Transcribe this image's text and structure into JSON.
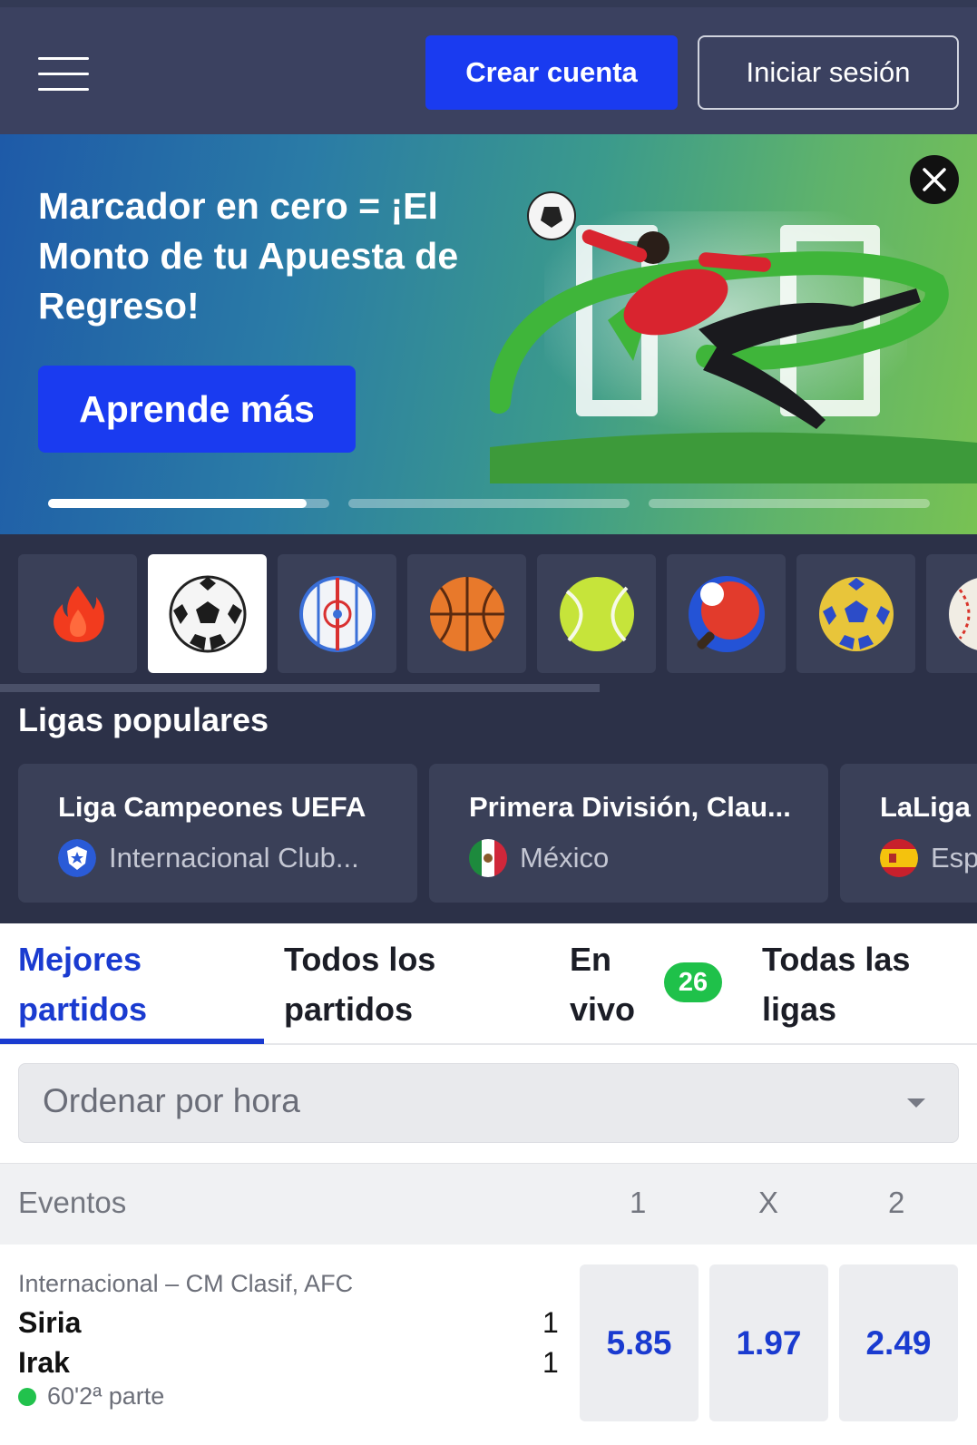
{
  "header": {
    "create_account": "Crear cuenta",
    "login": "Iniciar sesión"
  },
  "banner": {
    "title": "Marcador en cero = ¡El Monto de tu Apuesta de Regreso!",
    "cta": "Aprende más",
    "slides": [
      {
        "progress": 0.92
      },
      {
        "progress": 0
      },
      {
        "progress": 0
      }
    ]
  },
  "sports": [
    {
      "icon": "fire-icon",
      "active": false
    },
    {
      "icon": "soccer-ball-icon",
      "active": true
    },
    {
      "icon": "ice-hockey-icon",
      "active": false
    },
    {
      "icon": "basketball-icon",
      "active": false
    },
    {
      "icon": "tennis-ball-icon",
      "active": false
    },
    {
      "icon": "table-tennis-icon",
      "active": false
    },
    {
      "icon": "handball-icon",
      "active": false
    },
    {
      "icon": "baseball-icon",
      "active": false
    }
  ],
  "leagues": {
    "title": "Ligas populares",
    "items": [
      {
        "name": "Liga Campeones UEFA",
        "country": "Internacional Club...",
        "flag": "international-club-icon"
      },
      {
        "name": "Primera División, Clau...",
        "country": "México",
        "flag": "mexico-flag-icon"
      },
      {
        "name": "LaLiga",
        "country": "Esp",
        "flag": "spain-flag-icon"
      }
    ]
  },
  "tabs": {
    "best": "Mejores partidos",
    "all": "Todos los partidos",
    "live": "En vivo",
    "live_count": "26",
    "all_leagues": "Todas las ligas"
  },
  "sort": {
    "value": "Ordenar por hora"
  },
  "events_header": {
    "events": "Eventos",
    "col1": "1",
    "colx": "X",
    "col2": "2"
  },
  "matches": [
    {
      "league": "Internacional – CM Clasif, AFC",
      "home": "Siria",
      "away": "Irak",
      "home_score": "1",
      "away_score": "1",
      "time": "60'2ª parte",
      "odds": [
        "5.85",
        "1.97",
        "2.49"
      ]
    }
  ],
  "colors": {
    "header_bg": "#3b4160",
    "dark_bg": "#2c3148",
    "card_bg": "#3a4058",
    "primary": "#1a3bf0",
    "link": "#1a3bd0",
    "live_green": "#1fc14a"
  }
}
